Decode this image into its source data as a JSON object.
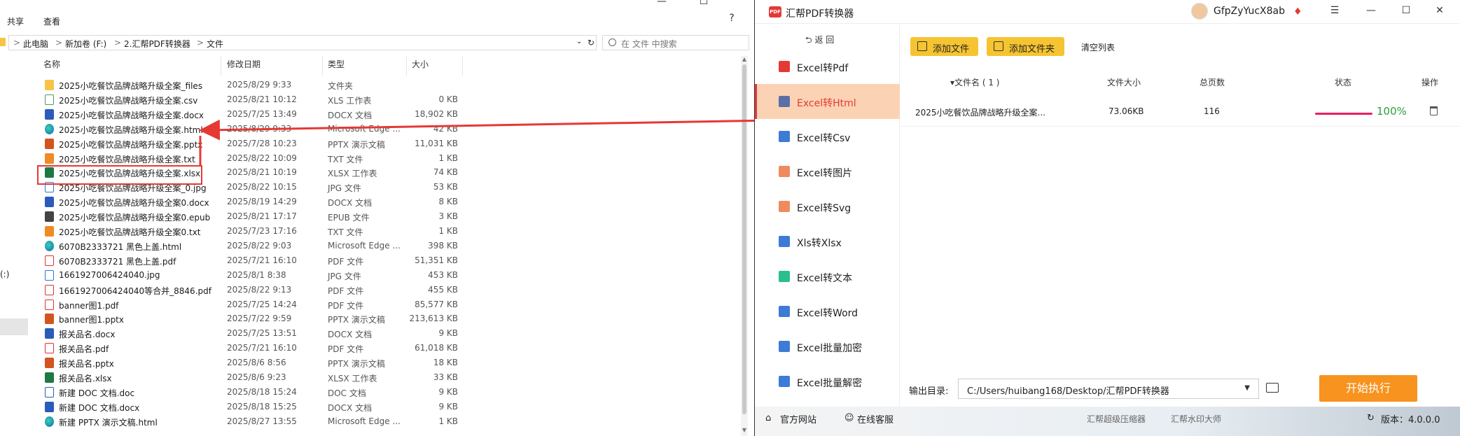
{
  "explorer": {
    "ribbon_tabs": [
      "共享",
      "查看"
    ],
    "window_controls": [
      "—",
      "☐",
      "✕"
    ],
    "breadcrumb": [
      "此电脑",
      "新加卷 (F:)",
      "2.汇帮PDF转换器",
      "文件"
    ],
    "breadcrumb_sep": ">",
    "search_placeholder": "在 文件 中搜索",
    "columns": {
      "name": "名称",
      "date": "修改日期",
      "type": "类型",
      "size": "大小"
    },
    "nav_fragment": "(:)",
    "files": [
      {
        "name": "2025小吃餐饮品牌战略升级全案_files",
        "date": "2025/8/29 9:33",
        "type": "文件夹",
        "size": "",
        "icon": "folder-icon"
      },
      {
        "name": "2025小吃餐饮品牌战略升级全案.csv",
        "date": "2025/8/21 10:12",
        "type": "XLS 工作表",
        "size": "0 KB",
        "icon": "csv-icon"
      },
      {
        "name": "2025小吃餐饮品牌战略升级全案.docx",
        "date": "2025/7/25 13:49",
        "type": "DOCX 文档",
        "size": "18,902 KB",
        "icon": "word-icon"
      },
      {
        "name": "2025小吃餐饮品牌战略升级全案.html",
        "date": "2025/8/29 9:33",
        "type": "Microsoft Edge ...",
        "size": "42 KB",
        "icon": "edge-icon"
      },
      {
        "name": "2025小吃餐饮品牌战略升级全案.pptx",
        "date": "2025/7/28 10:23",
        "type": "PPTX 演示文稿",
        "size": "11,031 KB",
        "icon": "ppt-icon"
      },
      {
        "name": "2025小吃餐饮品牌战略升级全案.txt",
        "date": "2025/8/22 10:09",
        "type": "TXT 文件",
        "size": "1 KB",
        "icon": "sublime-icon"
      },
      {
        "name": "2025小吃餐饮品牌战略升级全案.xlsx",
        "date": "2025/8/21 10:19",
        "type": "XLSX 工作表",
        "size": "74 KB",
        "icon": "xlsx-icon"
      },
      {
        "name": "2025小吃餐饮品牌战略升级全案_0.jpg",
        "date": "2025/8/22 10:15",
        "type": "JPG 文件",
        "size": "53 KB",
        "icon": "jpg-icon"
      },
      {
        "name": "2025小吃餐饮品牌战略升级全案0.docx",
        "date": "2025/8/19 14:29",
        "type": "DOCX 文档",
        "size": "8 KB",
        "icon": "word-icon"
      },
      {
        "name": "2025小吃餐饮品牌战略升级全案0.epub",
        "date": "2025/8/21 17:17",
        "type": "EPUB 文件",
        "size": "3 KB",
        "icon": "epub-icon"
      },
      {
        "name": "2025小吃餐饮品牌战略升级全案0.txt",
        "date": "2025/7/23 17:16",
        "type": "TXT 文件",
        "size": "1 KB",
        "icon": "sublime-icon"
      },
      {
        "name": "6070B2333721 黑色上盖.html",
        "date": "2025/8/22 9:03",
        "type": "Microsoft Edge ...",
        "size": "398 KB",
        "icon": "edge-icon"
      },
      {
        "name": "6070B2333721 黑色上盖.pdf",
        "date": "2025/7/21 16:10",
        "type": "PDF 文件",
        "size": "51,351 KB",
        "icon": "pdf-icon"
      },
      {
        "name": "1661927006424040.jpg",
        "date": "2025/8/1 8:38",
        "type": "JPG 文件",
        "size": "453 KB",
        "icon": "jpg-icon"
      },
      {
        "name": "1661927006424040等合并_8846.pdf",
        "date": "2025/8/22 9:13",
        "type": "PDF 文件",
        "size": "455 KB",
        "icon": "pdf-icon"
      },
      {
        "name": "banner图1.pdf",
        "date": "2025/7/25 14:24",
        "type": "PDF 文件",
        "size": "85,577 KB",
        "icon": "pdf-icon"
      },
      {
        "name": "banner图1.pptx",
        "date": "2025/7/22 9:59",
        "type": "PPTX 演示文稿",
        "size": "213,613 KB",
        "icon": "ppt-icon"
      },
      {
        "name": "报关品名.docx",
        "date": "2025/7/25 13:51",
        "type": "DOCX 文档",
        "size": "9 KB",
        "icon": "word-icon"
      },
      {
        "name": "报关品名.pdf",
        "date": "2025/7/21 16:10",
        "type": "PDF 文件",
        "size": "61,018 KB",
        "icon": "pdf-icon"
      },
      {
        "name": "报关品名.pptx",
        "date": "2025/8/6 8:56",
        "type": "PPTX 演示文稿",
        "size": "18 KB",
        "icon": "ppt-icon"
      },
      {
        "name": "报关品名.xlsx",
        "date": "2025/8/6 9:23",
        "type": "XLSX 工作表",
        "size": "33 KB",
        "icon": "xlsx-icon"
      },
      {
        "name": "新建 DOC 文档.doc",
        "date": "2025/8/18 15:24",
        "type": "DOC 文档",
        "size": "9 KB",
        "icon": "doc-icon"
      },
      {
        "name": "新建 DOC 文档.docx",
        "date": "2025/8/18 15:25",
        "type": "DOCX 文档",
        "size": "9 KB",
        "icon": "word-icon"
      },
      {
        "name": "新建 PPTX 演示文稿.html",
        "date": "2025/8/27 13:55",
        "type": "Microsoft Edge ...",
        "size": "1 KB",
        "icon": "edge-icon"
      }
    ]
  },
  "app": {
    "title": "汇帮PDF转换器",
    "logo_text": "PDF",
    "username": "GfpZyYucX8ab",
    "title_controls": [
      "☰",
      "—",
      "☐",
      "✕"
    ],
    "back_label": "返 回",
    "sidebar": [
      {
        "label": "Excel转Pdf",
        "icon": "pdf-icon",
        "color": "#e53935",
        "active": false
      },
      {
        "label": "Excel转Html",
        "icon": "html-icon",
        "color": "#5b6ea8",
        "active": true
      },
      {
        "label": "Excel转Csv",
        "icon": "csv-icon",
        "color": "#3d7bd6",
        "active": false
      },
      {
        "label": "Excel转图片",
        "icon": "image-icon",
        "color": "#f08a5d",
        "active": false
      },
      {
        "label": "Excel转Svg",
        "icon": "svg-icon",
        "color": "#f08a5d",
        "active": false
      },
      {
        "label": "Xls转Xlsx",
        "icon": "xlsx-icon",
        "color": "#3d7bd6",
        "active": false
      },
      {
        "label": "Excel转文本",
        "icon": "text-icon",
        "color": "#2bbf8a",
        "active": false
      },
      {
        "label": "Excel转Word",
        "icon": "word-icon",
        "color": "#3d7bd6",
        "active": false
      },
      {
        "label": "Excel批量加密",
        "icon": "lock-icon",
        "color": "#3d7bd6",
        "active": false
      },
      {
        "label": "Excel批量解密",
        "icon": "unlock-icon",
        "color": "#3d7bd6",
        "active": false
      }
    ],
    "toolbar": {
      "add_file": "添加文件",
      "add_folder": "添加文件夹",
      "clear_list": "清空列表"
    },
    "table": {
      "headers": {
        "name": "▾文件名 ( 1 )",
        "size": "文件大小",
        "pages": "总页数",
        "status": "状态",
        "action": "操作"
      },
      "rows": [
        {
          "name": "2025小吃餐饮品牌战略升级全案...",
          "size": "73.06KB",
          "pages": "116",
          "progress": 1.0,
          "progress_label": "100%"
        }
      ]
    },
    "output": {
      "label": "输出目录:",
      "path": "C:/Users/huibang168/Desktop/汇帮PDF转换器"
    },
    "start_label": "开始执行",
    "footer": {
      "website": "官方网站",
      "support": "在线客服",
      "link1": "汇帮超级压缩器",
      "link2": "汇帮水印大师",
      "version": "版本：4.0.0.0"
    }
  }
}
